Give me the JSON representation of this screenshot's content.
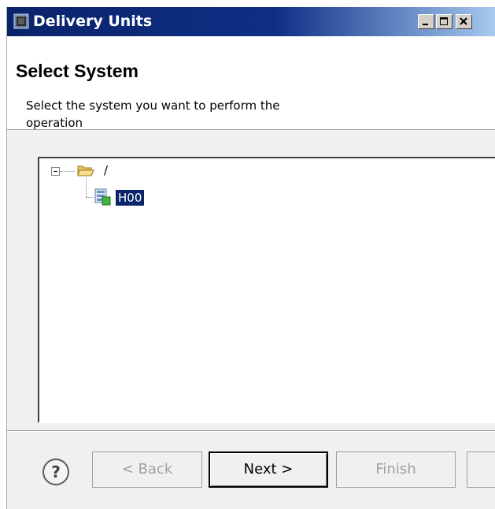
{
  "window": {
    "title": "Delivery Units",
    "controls": [
      "minimize",
      "maximize",
      "close"
    ]
  },
  "header": {
    "title": "Select System",
    "description": "Select the system you want to perform the operation"
  },
  "tree": {
    "root": {
      "label": "/",
      "icon": "open-folder-icon",
      "expanded": true
    },
    "children": [
      {
        "label": "H00",
        "icon": "system-icon",
        "selected": true
      }
    ]
  },
  "buttons": {
    "back": "< Back",
    "next": "Next >",
    "finish": "Finish"
  },
  "colors": {
    "titlebar": "#0a246a",
    "selection": "#0a246a",
    "dialog_bg": "#f0f0f0"
  }
}
